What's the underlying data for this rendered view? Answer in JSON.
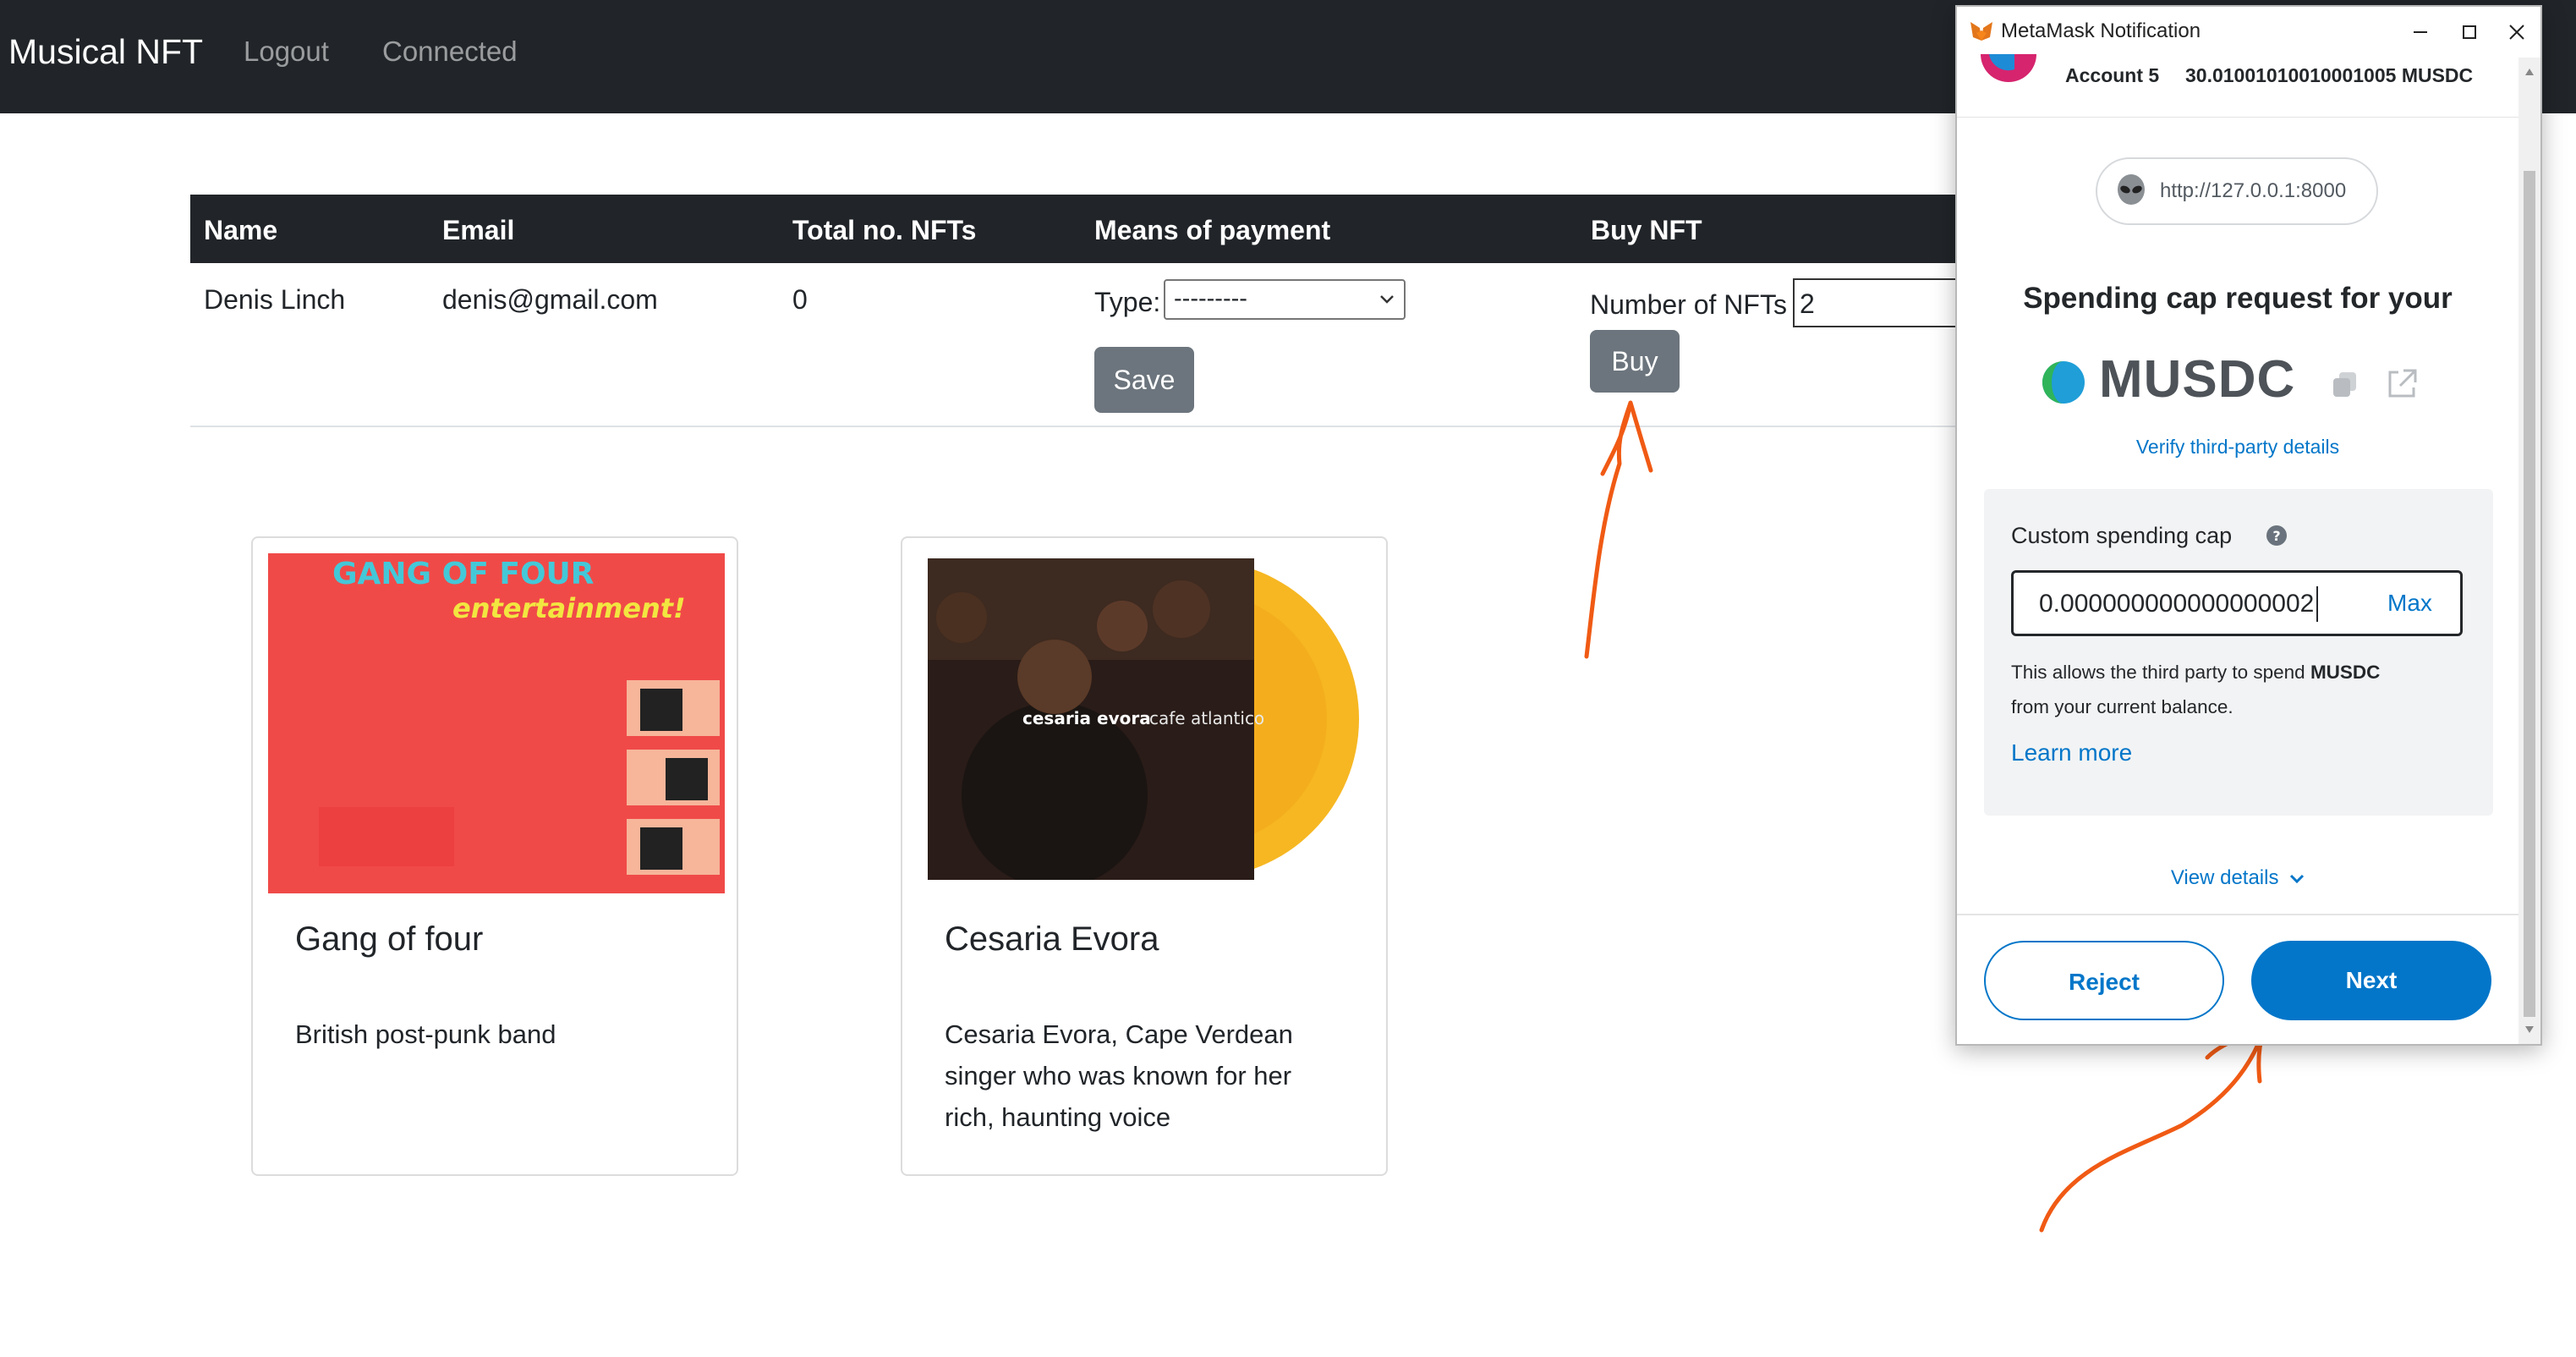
{
  "navbar": {
    "brand": "Musical NFT",
    "links": [
      "Logout",
      "Connected"
    ]
  },
  "table": {
    "headers": [
      "Name",
      "Email",
      "Total no. NFTs",
      "Means of payment",
      "Buy NFT"
    ],
    "row": {
      "name": "Denis Linch",
      "email": "denis@gmail.com",
      "total_nfts": "0",
      "type_label": "Type:",
      "type_value": "---------",
      "save_label": "Save",
      "nfts_label": "Number of NFTs",
      "nfts_value": "2",
      "buy_label": "Buy"
    }
  },
  "cards": [
    {
      "title": "Gang of four",
      "text": "British post-punk band",
      "cover_title": "GANG OF FOUR",
      "cover_subtitle": "entertainment!"
    },
    {
      "title": "Cesaria Evora",
      "text": "Cesaria Evora, Cape Verdean singer who was known for her rich, haunting voice",
      "cover_artist": "cesaria evora",
      "cover_album": "cafe atlantico"
    }
  ],
  "metamask": {
    "window_title": "MetaMask Notification",
    "account_name": "Account 5",
    "balance": "30.010010100100010​05 MUSDC",
    "origin": "http://127.0.0.1:8000",
    "heading": "Spending cap request for your",
    "token": "MUSDC",
    "verify_link": "Verify third-party details",
    "cap_label": "Custom spending cap",
    "cap_value": "0.000000000000000002",
    "max_label": "Max",
    "desc_prefix": "This allows the third party to spend ",
    "desc_token": "MUSDC",
    "desc_suffix": " from your current balance.",
    "learn_more": "Learn more",
    "view_details": "View details",
    "reject_label": "Reject",
    "next_label": "Next",
    "accent_color": "#0376c9"
  },
  "colors": {
    "navbar_bg": "#212529",
    "button_grey": "#6c757d",
    "annotation_arrow": "#f05a14"
  }
}
